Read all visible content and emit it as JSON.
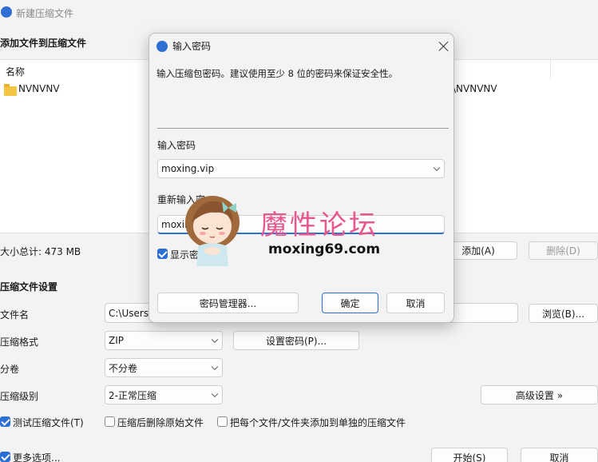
{
  "window": {
    "title": "新建压缩文件",
    "section_add": "添加文件到压缩文件",
    "column_name": "名称",
    "file_item": "NVNVNV",
    "file_path_fragment": "\\NVNVNV",
    "total_size": "大小总计: 473 MB",
    "add_button": "添加(A)",
    "delete_button": "删除(D)",
    "settings_section": "压缩文件设置",
    "filename_label": "文件名",
    "filename_value": "C:\\Users\\",
    "browse_button": "浏览(B)...",
    "format_label": "压缩格式",
    "format_value": "ZIP",
    "set_password_button": "设置密码(P)...",
    "split_label": "分卷",
    "split_value": "不分卷",
    "level_label": "压缩级别",
    "level_value": "2-正常压缩",
    "advanced_button": "高级设置 »",
    "test_checkbox": "测试压缩文件(T)",
    "delete_after_checkbox": "压缩后删除原始文件",
    "separate_checkbox": "把每个文件/文件夹添加到单独的压缩文件",
    "more_options": "更多选项...",
    "start_button": "开始(S)",
    "cancel_button": "取消"
  },
  "dialog": {
    "title": "输入密码",
    "description": "输入压缩包密码。建议使用至少 8 位的密码来保证安全性。",
    "password_label": "输入密码",
    "password_value": "moxing.vip",
    "reenter_label": "重新输入密",
    "reenter_value": "moxin",
    "show_password": "显示密",
    "manager_button": "密码管理器...",
    "ok_button": "确定",
    "cancel_button": "取消"
  },
  "watermark": {
    "title": "魔性论坛",
    "domain": "moxing69.com"
  },
  "colors": {
    "accent": "#2b6fd6",
    "watermark_pink": "#e9578f"
  }
}
